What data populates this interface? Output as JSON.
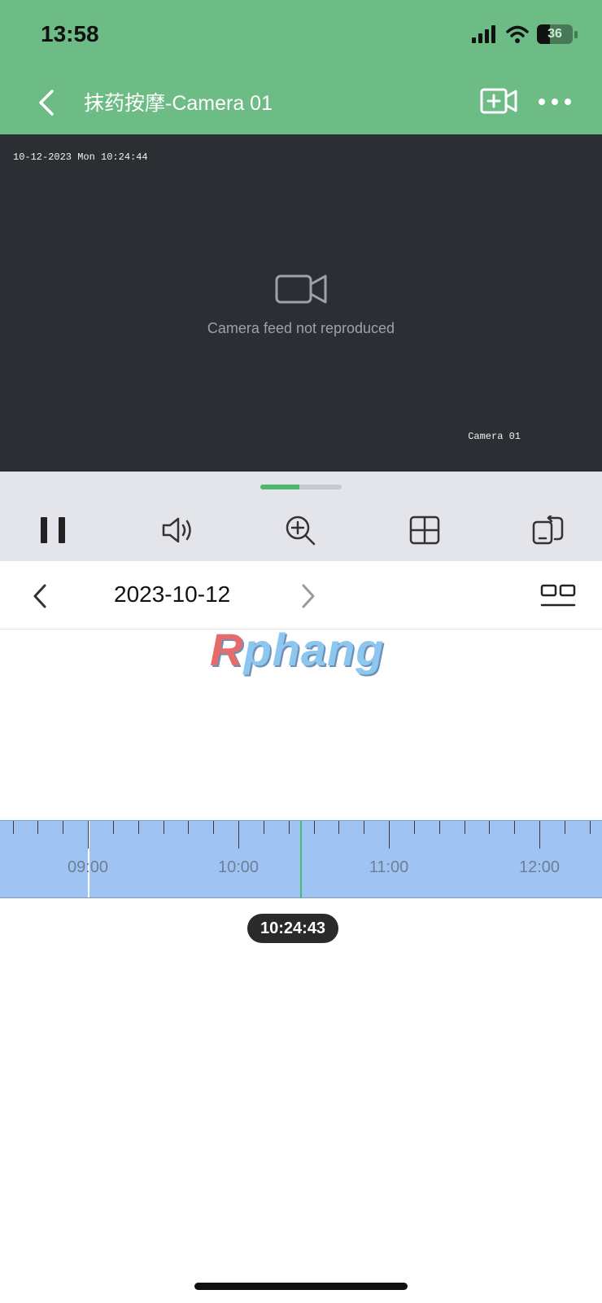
{
  "status_bar": {
    "time": "13:58",
    "battery_level": "36",
    "icons": [
      "cellular-signal-icon",
      "wifi-icon",
      "battery-icon"
    ]
  },
  "nav": {
    "title": "抹药按摩-Camera 01",
    "icons": [
      "back-chevron-icon",
      "add-video-icon",
      "more-dots-icon"
    ]
  },
  "video": {
    "osd_timestamp": "10-12-2023 Mon 10:24:44",
    "osd_camera": "Camera 01",
    "placeholder_text": "Camera feed not reproduced"
  },
  "playback": {
    "progress": 0.48,
    "controls": [
      "pause-icon",
      "volume-icon",
      "zoom-in-icon",
      "grid-view-icon",
      "rotate-screen-icon"
    ]
  },
  "date_bar": {
    "date": "2023-10-12",
    "icons": [
      "prev-day-chevron-icon",
      "next-day-chevron-icon",
      "split-view-icon"
    ]
  },
  "watermark": {
    "text": "Rphang"
  },
  "timeline": {
    "hour_labels": [
      "09:00",
      "10:00",
      "11:00",
      "12:00"
    ],
    "current_time": "10:24:43"
  },
  "colors": {
    "header": "#6dbb85",
    "accent_green": "#4cb86a",
    "timeline_band": "#9fc4f3",
    "control_bar": "#e4e5ea"
  }
}
